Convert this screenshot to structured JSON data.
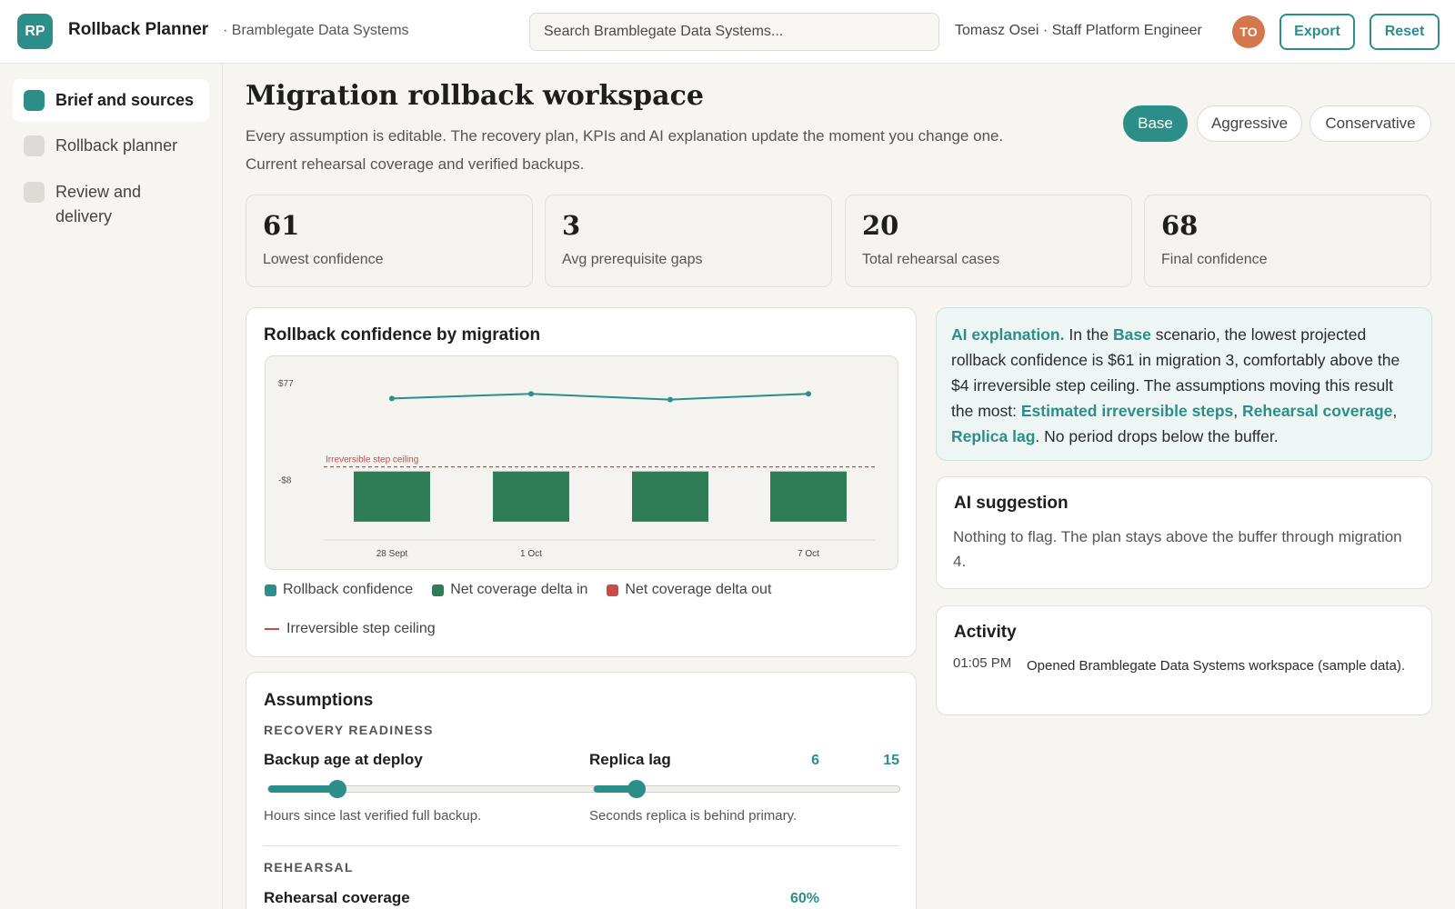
{
  "header": {
    "logo_initials": "RP",
    "app_title": "Rollback Planner",
    "org_name": "· Bramblegate Data Systems",
    "search_placeholder": "Search Bramblegate Data Systems...",
    "user_label": "Tomasz Osei · Staff Platform Engineer",
    "avatar_initials": "TO",
    "export_label": "Export",
    "reset_label": "Reset"
  },
  "sidebar": {
    "items": [
      {
        "label": "Brief and sources",
        "active": true
      },
      {
        "label": "Rollback planner",
        "active": false
      },
      {
        "label": "Review and delivery",
        "active": false
      }
    ]
  },
  "main": {
    "title": "Migration rollback workspace",
    "subtitle": "Every assumption is editable. The recovery plan, KPIs and AI explanation update the moment you change one.",
    "subtitle2": "Current rehearsal coverage and verified backups.",
    "scenarios": [
      {
        "label": "Base",
        "active": true
      },
      {
        "label": "Aggressive",
        "active": false
      },
      {
        "label": "Conservative",
        "active": false
      }
    ]
  },
  "kpis": [
    {
      "value": "61",
      "label": "Lowest confidence"
    },
    {
      "value": "3",
      "label": "Avg prerequisite gaps"
    },
    {
      "value": "20",
      "label": "Total rehearsal cases"
    },
    {
      "value": "68",
      "label": "Final confidence"
    }
  ],
  "chart_panel": {
    "title": "Rollback confidence by migration",
    "legend": {
      "confidence": "Rollback confidence",
      "delta_in": "Net coverage delta in",
      "delta_out": "Net coverage delta out",
      "ceiling": "Irreversible step ceiling"
    }
  },
  "chart_data": {
    "type": "line",
    "x": [
      "28 Sept",
      "1 Oct",
      "",
      "7 Oct"
    ],
    "series": [
      {
        "name": "Rollback confidence",
        "type": "line",
        "values": [
          64,
          68,
          63,
          68
        ]
      },
      {
        "name": "Net coverage delta in",
        "type": "bar",
        "values": [
          -44,
          -44,
          -44,
          -44
        ]
      },
      {
        "name": "Net coverage delta out",
        "type": "bar",
        "values": [
          0,
          0,
          0,
          0
        ]
      }
    ],
    "reference_line": {
      "label": "Irreversible step ceiling",
      "value": 4
    },
    "y_tick_labels": [
      "$77",
      "-$8"
    ],
    "ylim": [
      -60,
      77
    ],
    "grid": false,
    "colors": {
      "line": "#2b8e89",
      "bar_in": "#2e7d57",
      "bar_out": "#c94a46",
      "ceiling": "#c94a46"
    }
  },
  "assumptions": {
    "title": "Assumptions",
    "section_recovery": "RECOVERY READINESS",
    "backup": {
      "label": "Backup age at deploy",
      "value": "6",
      "help": "Hours since last verified full backup.",
      "fraction": 0.125
    },
    "replica": {
      "label": "Replica lag",
      "value": "15",
      "help": "Seconds replica is behind primary.",
      "fraction": 0.14
    },
    "section_rehearsal": "REHEARSAL",
    "coverage": {
      "label": "Rehearsal coverage",
      "value": "60%"
    }
  },
  "ai_explanation": {
    "lead": "AI explanation.",
    "t1": " In the ",
    "scenario": "Base",
    "t2": " scenario, the lowest projected rollback confidence is $61 in migration 3, comfortably above the $4 irreversible step ceiling. The assumptions moving this result the most: ",
    "d1": "Estimated irreversible steps",
    "sep1": ", ",
    "d2": "Rehearsal coverage",
    "sep2": ", ",
    "d3": "Replica lag",
    "t3": ". No period drops below the buffer."
  },
  "ai_suggestion": {
    "title": "AI suggestion",
    "text": "Nothing to flag. The plan stays above the buffer through migration 4."
  },
  "activity": {
    "title": "Activity",
    "time": "01:05 PM",
    "text": "Opened Bramblegate Data Systems workspace (sample data)."
  }
}
